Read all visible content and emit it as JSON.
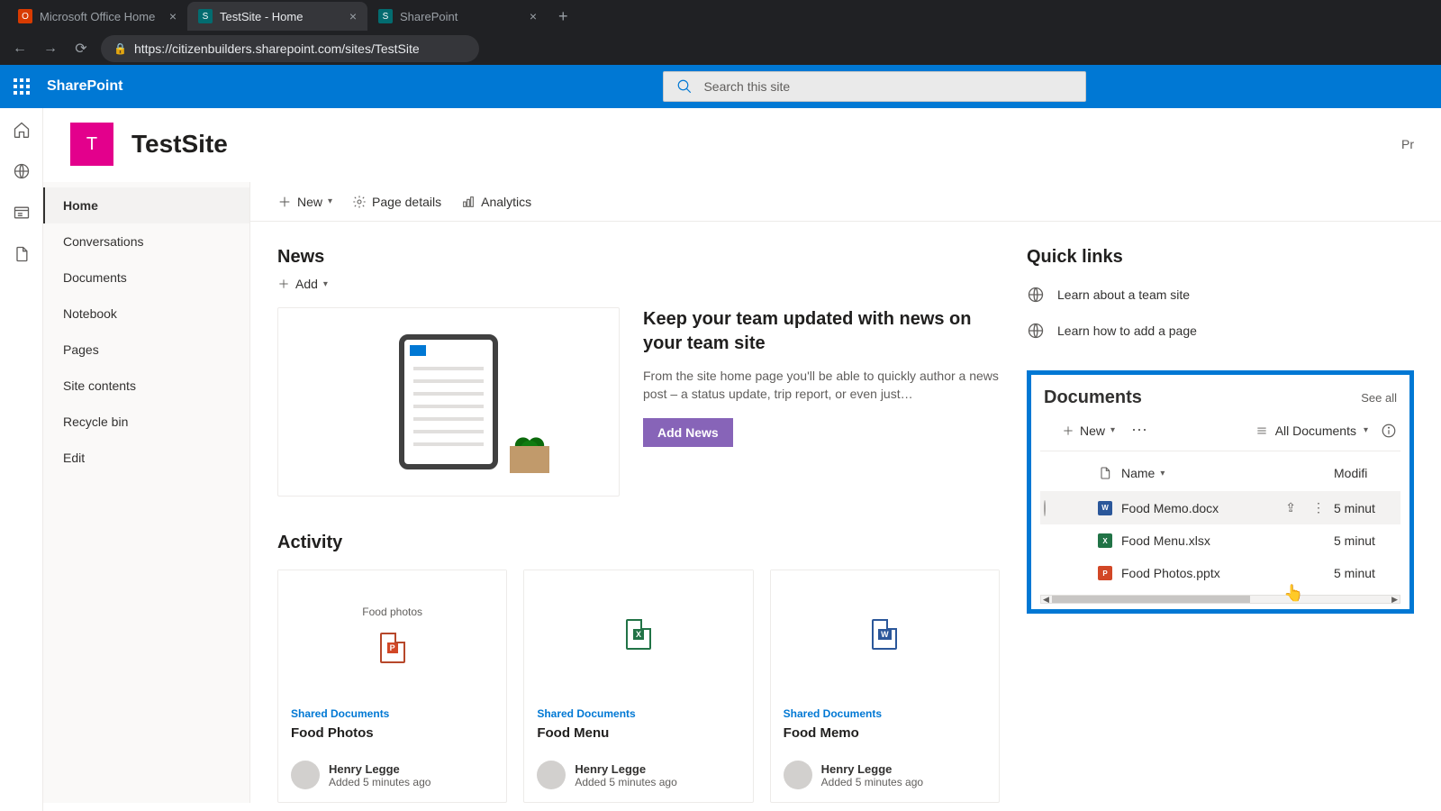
{
  "browser": {
    "tabs": [
      {
        "title": "Microsoft Office Home",
        "active": false
      },
      {
        "title": "TestSite - Home",
        "active": true
      },
      {
        "title": "SharePoint",
        "active": false
      }
    ],
    "url": "https://citizenbuilders.sharepoint.com/sites/TestSite"
  },
  "suite": {
    "product": "SharePoint",
    "search_placeholder": "Search this site"
  },
  "site": {
    "logo_letter": "T",
    "title": "TestSite",
    "right_truncated": "Pr"
  },
  "leftnav": {
    "items": [
      "Home",
      "Conversations",
      "Documents",
      "Notebook",
      "Pages",
      "Site contents",
      "Recycle bin",
      "Edit"
    ],
    "active": "Home"
  },
  "commandbar": {
    "new_label": "New",
    "page_details": "Page details",
    "analytics": "Analytics"
  },
  "news": {
    "heading": "News",
    "add": "Add",
    "title": "Keep your team updated with news on your team site",
    "body": "From the site home page you'll be able to quickly author a news post – a status update, trip report, or even just…",
    "button": "Add News"
  },
  "activity": {
    "heading": "Activity",
    "cards": [
      {
        "preview_label": "Food photos",
        "type": "ppt",
        "library": "Shared Documents",
        "name": "Food Photos",
        "user": "Henry Legge",
        "sub": "Added 5 minutes ago"
      },
      {
        "preview_label": "",
        "type": "xls",
        "library": "Shared Documents",
        "name": "Food Menu",
        "user": "Henry Legge",
        "sub": "Added 5 minutes ago"
      },
      {
        "preview_label": "",
        "type": "doc",
        "library": "Shared Documents",
        "name": "Food Memo",
        "user": "Henry Legge",
        "sub": "Added 5 minutes ago"
      }
    ]
  },
  "quicklinks": {
    "heading": "Quick links",
    "items": [
      "Learn about a team site",
      "Learn how to add a page"
    ]
  },
  "documents": {
    "heading": "Documents",
    "see_all": "See all",
    "new": "New",
    "view": "All Documents",
    "col_name": "Name",
    "col_modified": "Modifi",
    "rows": [
      {
        "type": "doc",
        "name": "Food Memo.docx",
        "modified": "5 minut",
        "hover": true
      },
      {
        "type": "xls",
        "name": "Food Menu.xlsx",
        "modified": "5 minut",
        "hover": false
      },
      {
        "type": "ppt",
        "name": "Food Photos.pptx",
        "modified": "5 minut",
        "hover": false
      }
    ]
  }
}
